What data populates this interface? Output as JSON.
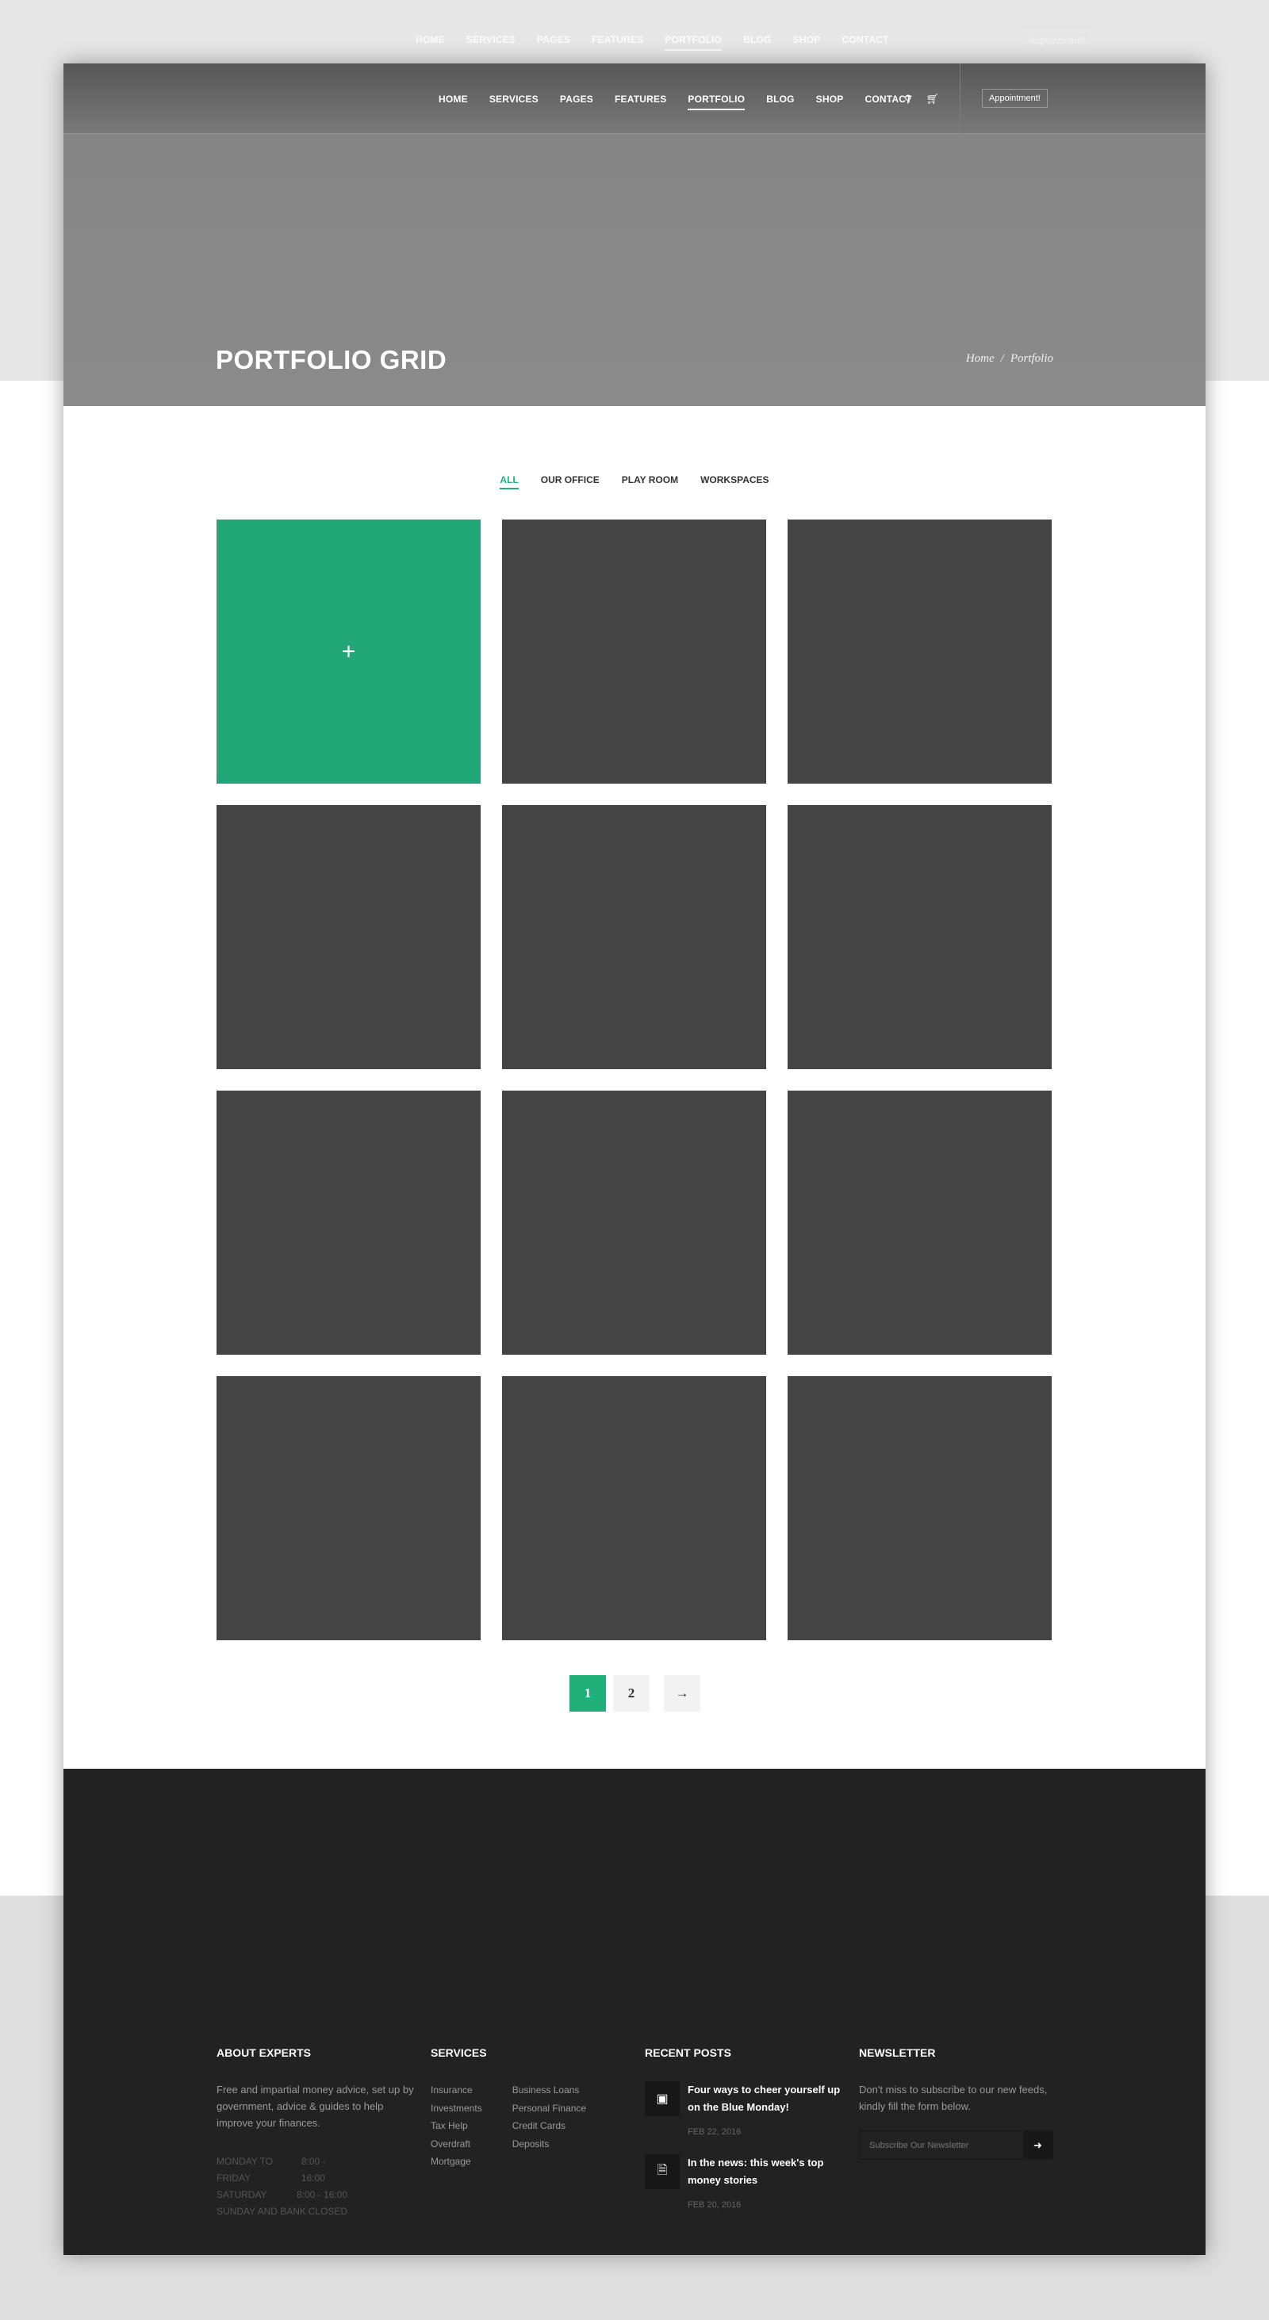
{
  "nav": {
    "items": [
      "HOME",
      "SERVICES",
      "PAGES",
      "FEATURES",
      "PORTFOLIO",
      "BLOG",
      "SHOP",
      "CONTACT"
    ],
    "active": "PORTFOLIO",
    "search_icon": "search-icon",
    "cart_icon": "cart-icon",
    "appointment": "Appointment!"
  },
  "hero": {
    "title": "PORTFOLIO GRID",
    "breadcrumb": [
      "Home",
      "Portfolio"
    ],
    "separator": "/"
  },
  "filters": {
    "items": [
      "ALL",
      "OUR OFFICE",
      "PLAY ROOM",
      "WORKSPACES"
    ],
    "active": "ALL"
  },
  "portfolio": {
    "tile_count": 12,
    "hovered_index": 0,
    "hover_icon": "+"
  },
  "pagination": {
    "pages": [
      "1",
      "2"
    ],
    "current": "1",
    "next": "→"
  },
  "colors": {
    "accent": "#1fb07a",
    "tile": "#444444",
    "footer": "#222222",
    "hero": "#8a8a8a"
  },
  "footer": {
    "about": {
      "heading": "ABOUT EXPERTS",
      "text": "Free and impartial money advice, set up by government, advice & guides to help improve your finances.",
      "hours": [
        [
          "MONDAY TO FRIDAY",
          "8:00 - 16:00"
        ],
        [
          "SATURDAY",
          "8:00 - 16:00"
        ],
        [
          "SUNDAY AND BANK",
          "CLOSED"
        ]
      ]
    },
    "services": {
      "heading": "SERVICES",
      "col1": [
        "Insurance",
        "Investments",
        "Tax Help",
        "Overdraft",
        "Mortgage"
      ],
      "col2": [
        "Business Loans",
        "Personal Finance",
        "Credit Cards",
        "Deposits"
      ]
    },
    "posts": {
      "heading": "RECENT POSTS",
      "items": [
        {
          "title": "Four ways to cheer yourself up on the Blue Monday!",
          "date": "FEB 22, 2016",
          "icon": "image-icon"
        },
        {
          "title": "In the news: this week's top money stories",
          "date": "FEB 20, 2016",
          "icon": "document-icon"
        }
      ]
    },
    "newsletter": {
      "heading": "NEWSLETTER",
      "text": "Don't miss to subscribe to our new feeds, kindly fill the form below.",
      "placeholder": "Subscribe Our Newsletter",
      "submit": "➜"
    }
  }
}
